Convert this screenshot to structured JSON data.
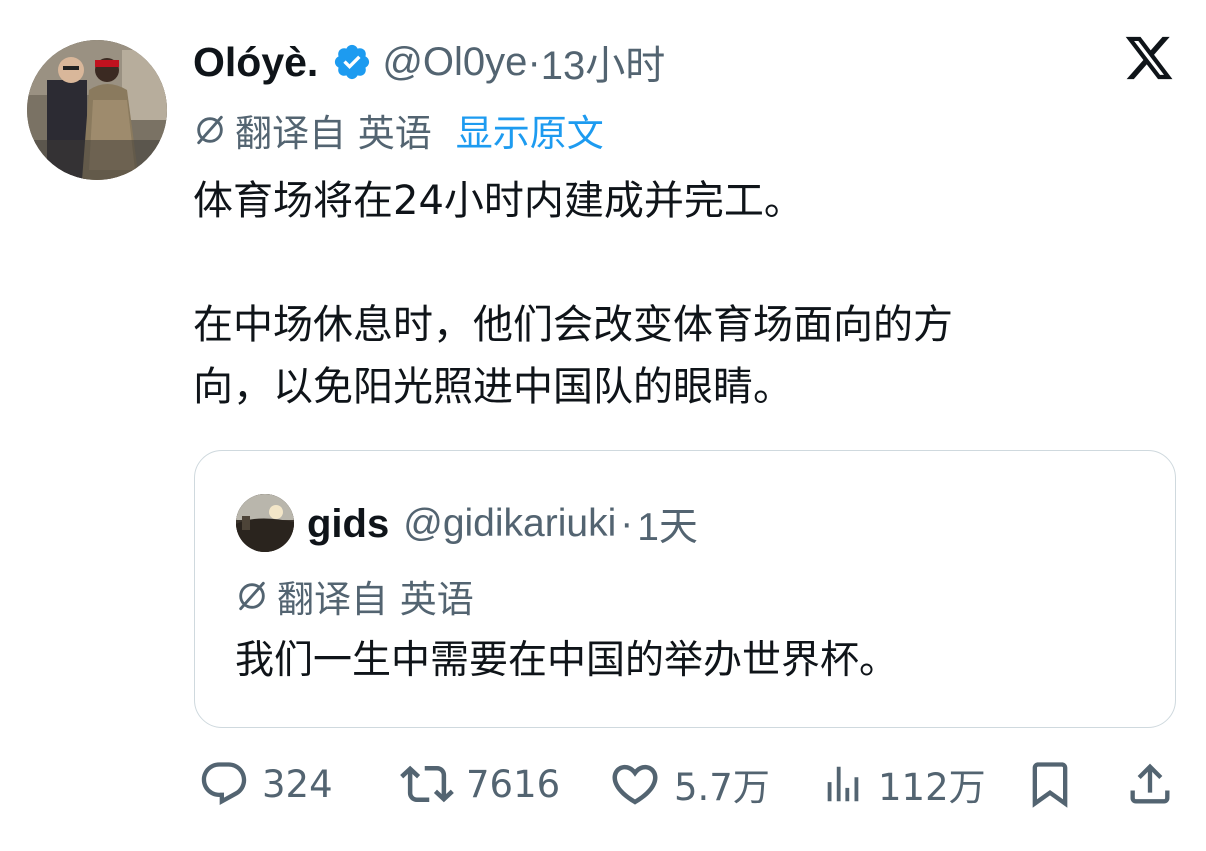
{
  "tweet": {
    "author": {
      "display_name": "Olóyè.",
      "verified": true,
      "handle": "@Ol0ye",
      "time": "13小时",
      "avatar_icon": "avatar-photo"
    },
    "translation": {
      "label": "翻译自 英语",
      "show_original": "显示原文"
    },
    "text_line1": "体育场将在24小时内建成并完工。",
    "text_line2": "在中场休息时，他们会改变体育场面向的方",
    "text_line3": "向，以免阳光照进中国队的眼睛。",
    "platform_icon": "x-logo",
    "colors": {
      "accent": "#1d9bf0",
      "secondary_text": "#536471",
      "primary_text": "#0f1419",
      "border": "#cfd9de"
    }
  },
  "quote": {
    "display_name": "gids",
    "handle": "@gidikariuki",
    "time": "1天",
    "translation_label": "翻译自 英语",
    "text": "我们一生中需要在中国的举办世界杯。"
  },
  "actions": {
    "replies": "324",
    "reposts": "7616",
    "likes": "5.7万",
    "views": "112万"
  }
}
